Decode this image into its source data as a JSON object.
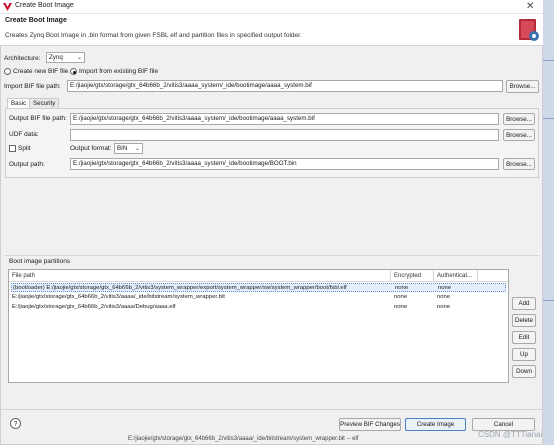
{
  "window": {
    "title": "Create Boot Image",
    "close_glyph": "✕",
    "app_icon": "vivado-logo-icon"
  },
  "header": {
    "title": "Create Boot Image",
    "description": "Creates Zynq Boot Image in .bin format from given FSBL elf and partition files in specified output folder.",
    "logo_icon": "boot-image-logo-icon"
  },
  "architecture": {
    "label": "Architecture:",
    "value": "Zynq",
    "arrow": "⌄"
  },
  "mode": {
    "new_label": "Create new BIF file",
    "import_label": "Import from existing BIF file",
    "selected": "import"
  },
  "import": {
    "label": "Import BIF file path:",
    "value": "E:/jiaojie/gtx/storage/gtx_64b66b_2/vitis3/aaaa_system/_ide/bootimage/aaaa_system.bif",
    "browse_label": "Browse..."
  },
  "tabs": [
    {
      "label": "Basic",
      "active": true
    },
    {
      "label": "Security",
      "active": false
    }
  ],
  "basic": {
    "output_bif_label": "Output BIF file path:",
    "output_bif_value": "E:/jiaojie/gtx/storage/gtx_64b66b_2/vitis3/aaaa_system/_ide/bootimage/aaaa_system.bif",
    "output_bif_browse": "Browse...",
    "udf_label": "UDF data:",
    "udf_value": "",
    "udf_browse": "Browse...",
    "split_label": "Split",
    "output_format_label": "Output format:",
    "output_format_value": "BIN",
    "output_format_arrow": "⌄",
    "output_path_label": "Output path:",
    "output_path_value": "E:/jiaojie/gtx/storage/gtx_64b66b_2/vitis3/aaaa_system/_ide/bootimage/BOOT.bin",
    "output_path_browse": "Browse..."
  },
  "partitions": {
    "title": "Boot image partitions",
    "columns": [
      "File path",
      "Encrypted",
      "Authenticat..."
    ],
    "rows": [
      {
        "path": "(bootloader) E:/jiaojie/gtx/storage/gtx_64b66b_2/vitis3/system_wrapper/export/system_wrapper/sw/system_wrapper/boot/fsbl.elf",
        "encrypted": "none",
        "auth": "none",
        "selected": true
      },
      {
        "path": "E:/jiaojie/gtx/storage/gtx_64b66b_2/vitis3/aaaa/_ide/bitstream/system_wrapper.bit",
        "encrypted": "none",
        "auth": "none",
        "selected": false
      },
      {
        "path": "E:/jiaojie/gtx/storage/gtx_64b66b_2/vitis3/aaaa/Debug/aaaa.elf",
        "encrypted": "none",
        "auth": "none",
        "selected": false
      }
    ],
    "buttons": {
      "add": "Add",
      "delete": "Delete",
      "edit": "Edit",
      "up": "Up",
      "down": "Down"
    }
  },
  "footer": {
    "help_glyph": "?",
    "preview_label": "Preview BIF Changes",
    "create_label": "Create Image",
    "cancel_label": "Cancel"
  },
  "background": {
    "bottom_text": "E:/jiaojie/gtx/storage/gtx_64b66b_2/vitis3/aaaa/_ide/bitstream/system_wrapper.bit -- elf",
    "watermark": "CSDN @TTTianai"
  }
}
